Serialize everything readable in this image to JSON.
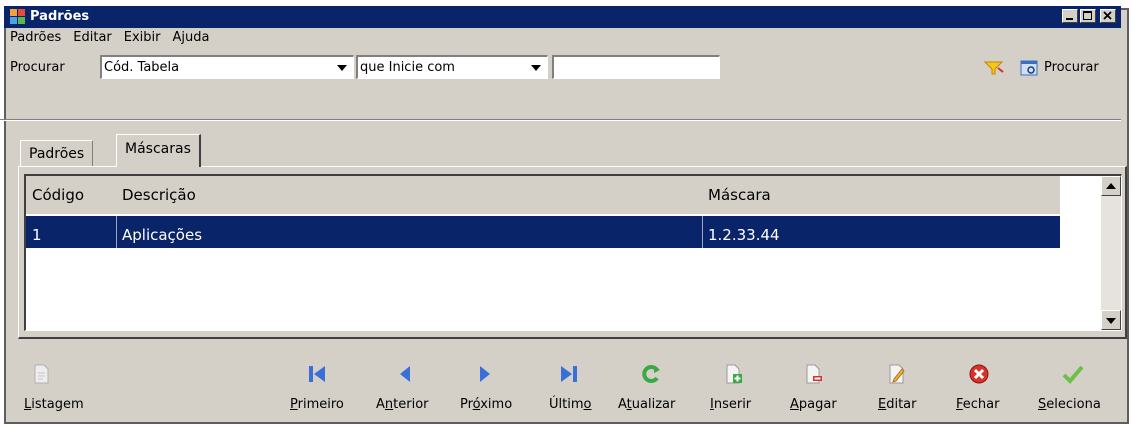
{
  "window": {
    "title": "Padrões"
  },
  "menu": [
    "Padrões",
    "Editar",
    "Exibir",
    "Ajuda"
  ],
  "search": {
    "label": "Procurar",
    "field_value": "Cód. Tabela",
    "operator_value": "que Inicie com",
    "text_value": "",
    "button_label": "Procurar"
  },
  "tabs": [
    {
      "label": "Padrões",
      "active": false
    },
    {
      "label": "Máscaras",
      "active": true
    }
  ],
  "grid": {
    "columns": [
      "Código",
      "Descrição",
      "Máscara"
    ],
    "rows": [
      {
        "codigo": "1",
        "descricao": "Aplicações",
        "mascara": "1.2.33.44",
        "selected": true
      }
    ]
  },
  "toolbar": [
    {
      "label": "Listagem",
      "ul_index": 0,
      "icon": "report-icon",
      "enabled": false
    },
    {
      "label": "Primeiro",
      "ul_index": 0,
      "icon": "first-record-icon",
      "enabled": true
    },
    {
      "label": "Anterior",
      "ul_index": 1,
      "icon": "previous-record-icon",
      "enabled": true
    },
    {
      "label": "Próximo",
      "ul_index": 2,
      "icon": "next-record-icon",
      "enabled": true
    },
    {
      "label": "Último",
      "ul_index": 5,
      "icon": "last-record-icon",
      "enabled": true
    },
    {
      "label": "Atualizar",
      "ul_index": 1,
      "icon": "refresh-icon",
      "enabled": true
    },
    {
      "label": "Inserir",
      "ul_index": 0,
      "icon": "insert-icon",
      "enabled": true
    },
    {
      "label": "Apagar",
      "ul_index": 0,
      "icon": "delete-icon",
      "enabled": true
    },
    {
      "label": "Editar",
      "ul_index": 0,
      "icon": "edit-icon",
      "enabled": true
    },
    {
      "label": "Fechar",
      "ul_index": 0,
      "icon": "close-icon",
      "enabled": true
    },
    {
      "label": "Seleciona",
      "ul_index": 0,
      "icon": "checkmark-icon",
      "enabled": true
    }
  ],
  "colors": {
    "title_bar": "#0a246a",
    "window_bg": "#d4d0c8",
    "selection": "#0a246a",
    "nav_blue": "#3a6fd8",
    "refresh_green": "#3aa845",
    "close_red": "#d8322a",
    "check_green": "#6cc04a"
  }
}
